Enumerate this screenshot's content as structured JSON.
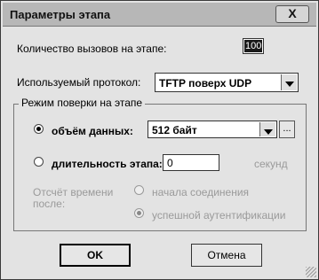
{
  "window": {
    "title": "Параметры этапа",
    "close_label": "X"
  },
  "calls": {
    "label": "Количество вызовов на этапе:",
    "value": "100"
  },
  "protocol": {
    "label": "Используемый протокол:",
    "value": "TFTP поверх UDP"
  },
  "mode_group": {
    "title": "Режим поверки на этапе",
    "data_volume": {
      "label": "объём данных:",
      "value": "512 байт",
      "browse_label": "...",
      "checked": true
    },
    "duration": {
      "label": "длительность этапа:",
      "value": "0",
      "unit": "секунд",
      "checked": false
    },
    "count_time": {
      "label_line1": "Отсчёт времени",
      "label_line2": "после:",
      "option_start": "начала соединения",
      "option_auth": "успешной аутентификации",
      "selected": "option_auth"
    }
  },
  "buttons": {
    "ok": "OK",
    "cancel": "Отмена"
  }
}
